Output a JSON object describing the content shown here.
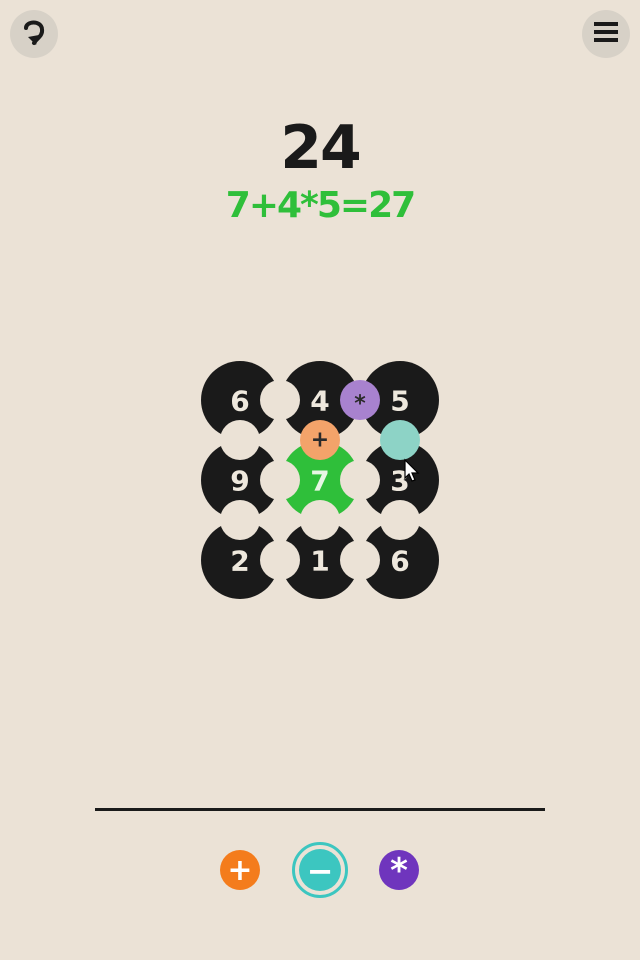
{
  "header": {
    "undo_icon": "undo-arrow-icon",
    "menu_icon": "hamburger-menu-icon"
  },
  "game": {
    "target": "24",
    "expression": "7+4*5=27",
    "expression_color": "#2fbf3a",
    "grid": [
      [
        "6",
        "4",
        "5"
      ],
      [
        "9",
        "7",
        "3"
      ],
      [
        "2",
        "1",
        "6"
      ]
    ],
    "selected_tile": "7",
    "placed_operators": [
      {
        "symbol": "+",
        "between": "7-4",
        "color": "#f3a36a"
      },
      {
        "symbol": "*",
        "between": "4-5",
        "color": "#a882cf"
      },
      {
        "symbol": "",
        "between": "5-3",
        "color": "#8dd3c6"
      }
    ]
  },
  "operators": {
    "plus_label": "+",
    "minus_label": "−",
    "multiply_label": "*",
    "plus_color": "#f47c1c",
    "minus_color": "#3cc6c0",
    "multiply_color": "#6f35bd",
    "active": "minus"
  },
  "colors": {
    "background": "#ebe2d6",
    "tile": "#1a1a1a",
    "selected_tile": "#2fbf3a"
  }
}
